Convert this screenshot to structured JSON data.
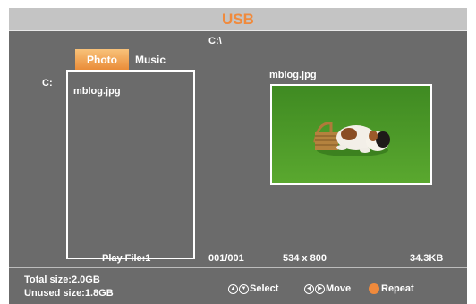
{
  "title": "USB",
  "colors": {
    "title": "#f08a3c",
    "tab_active": "#e98a36",
    "background": "#6b6b6b"
  },
  "tabs": [
    {
      "label": "Photo",
      "active": true
    },
    {
      "label": "Music",
      "active": false
    }
  ],
  "path": "C:\\",
  "drive": "C:",
  "files": [
    {
      "name": "mblog.jpg"
    }
  ],
  "preview": {
    "name": "mblog.jpg",
    "image": "dog-with-basket-on-grass"
  },
  "info": {
    "play_file": "Play File:1",
    "index": "001/001",
    "dimensions": "534 x 800",
    "size": "34.3KB"
  },
  "storage": {
    "total": "Total size:2.0GB",
    "unused": "Unused size:1.8GB"
  },
  "hints": {
    "select": "Select",
    "move": "Move",
    "repeat": "Repeat",
    "icons": [
      "up-down-arrows-icon",
      "left-right-arrows-icon",
      "repeat-icon"
    ]
  }
}
